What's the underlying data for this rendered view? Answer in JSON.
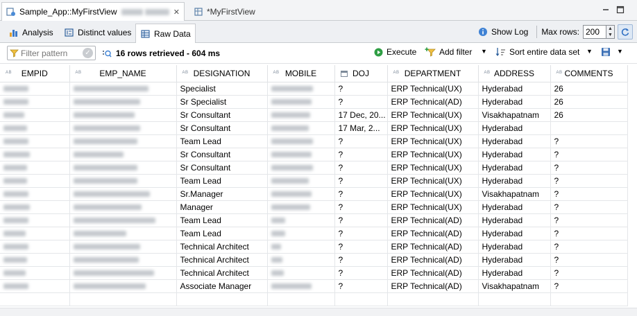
{
  "editor_tabs": [
    {
      "label": "Sample_App::MyFirstView",
      "close": "✕"
    },
    {
      "label": "*MyFirstView"
    }
  ],
  "view_tabs": [
    "Analysis",
    "Distinct values",
    "Raw Data"
  ],
  "show_log": "Show Log",
  "max_rows": {
    "label": "Max rows:",
    "value": "200"
  },
  "filter": {
    "placeholder": "Filter pattern"
  },
  "rows_info": "16 rows retrieved - 604 ms",
  "toolbar": {
    "execute": "Execute",
    "add_filter": "Add filter",
    "sort": "Sort entire data set"
  },
  "columns": [
    {
      "name": "EMPID",
      "type": "AB"
    },
    {
      "name": "EMP_NAME",
      "type": "AB"
    },
    {
      "name": "DESIGNATION",
      "type": "AB"
    },
    {
      "name": "MOBILE",
      "type": "AB"
    },
    {
      "name": "DOJ",
      "type": "date"
    },
    {
      "name": "DEPARTMENT",
      "type": "AB"
    },
    {
      "name": "ADDRESS",
      "type": "AB"
    },
    {
      "name": "COMMENTS",
      "type": "AB"
    }
  ],
  "rows": [
    {
      "designation": "Specialist",
      "doj": "?",
      "department": "ERP Technical(UX)",
      "address": "Hyderabad",
      "comments": "26"
    },
    {
      "designation": "Sr Specialist",
      "doj": "?",
      "department": "ERP Technical(AD)",
      "address": "Hyderabad",
      "comments": "26"
    },
    {
      "designation": "Sr Consultant",
      "doj": "17 Dec, 20...",
      "department": "ERP Technical(UX)",
      "address": "Visakhapatnam",
      "comments": "26"
    },
    {
      "designation": "Sr Consultant",
      "doj": "17 Mar, 2...",
      "department": "ERP Technical(UX)",
      "address": "Hyderabad",
      "comments": ""
    },
    {
      "designation": "Team Lead",
      "doj": "?",
      "department": "ERP Technical(UX)",
      "address": "Hyderabad",
      "comments": "?"
    },
    {
      "designation": "Sr Consultant",
      "doj": "?",
      "department": "ERP Technical(UX)",
      "address": "Hyderabad",
      "comments": "?"
    },
    {
      "designation": "Sr Consultant",
      "doj": "?",
      "department": "ERP Technical(UX)",
      "address": "Hyderabad",
      "comments": "?"
    },
    {
      "designation": "Team Lead",
      "doj": "?",
      "department": "ERP Technical(UX)",
      "address": "Hyderabad",
      "comments": "?"
    },
    {
      "designation": "Sr.Manager",
      "doj": "?",
      "department": "ERP Technical(UX)",
      "address": "Visakhapatnam",
      "comments": "?"
    },
    {
      "designation": "Manager",
      "doj": "?",
      "department": "ERP Technical(UX)",
      "address": "Hyderabad",
      "comments": "?"
    },
    {
      "designation": "Team Lead",
      "doj": "?",
      "department": "ERP Technical(AD)",
      "address": "Hyderabad",
      "comments": "?"
    },
    {
      "designation": "Team Lead",
      "doj": "?",
      "department": "ERP Technical(AD)",
      "address": "Hyderabad",
      "comments": "?"
    },
    {
      "designation": "Technical Architect",
      "doj": "?",
      "department": "ERP Technical(AD)",
      "address": "Hyderabad",
      "comments": "?"
    },
    {
      "designation": "Technical Architect",
      "doj": "?",
      "department": "ERP Technical(AD)",
      "address": "Hyderabad",
      "comments": "?"
    },
    {
      "designation": "Technical Architect",
      "doj": "?",
      "department": "ERP Technical(AD)",
      "address": "Hyderabad",
      "comments": "?"
    },
    {
      "designation": "Associate Manager",
      "doj": "?",
      "department": "ERP Technical(AD)",
      "address": "Visakhapatnam",
      "comments": "?"
    }
  ]
}
